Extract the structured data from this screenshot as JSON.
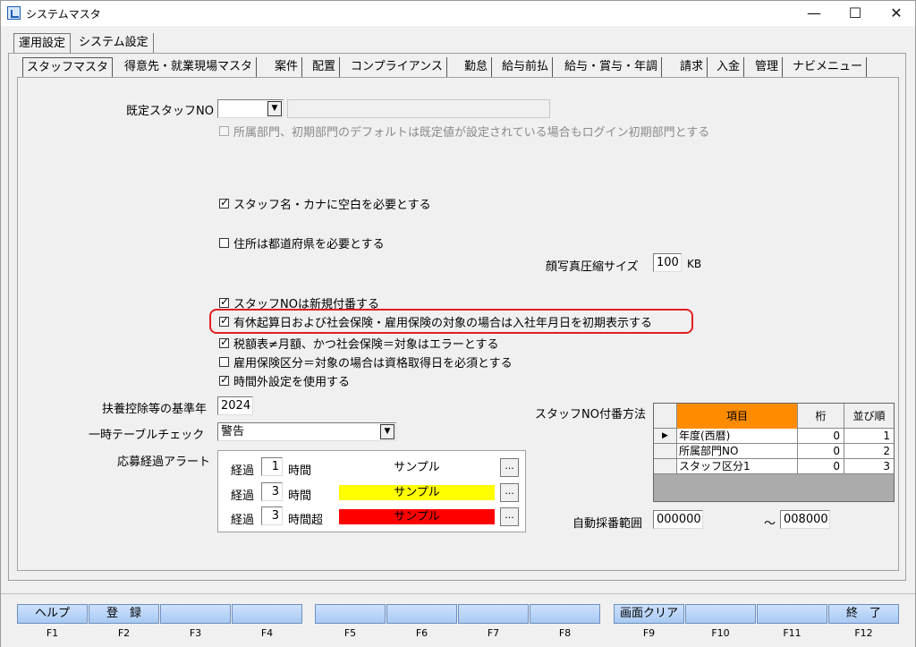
{
  "window": {
    "title": "システムマスタ",
    "minimize": "—",
    "maximize": "☐",
    "close": "✕"
  },
  "outer_tabs": [
    "運用設定",
    "システム設定"
  ],
  "inner_tabs": [
    "スタッフマスタ",
    "得意先・就業現場マスタ",
    "案件",
    "配置",
    "コンプライアンス",
    "勤怠",
    "給与前払",
    "給与・賞与・年調",
    "請求",
    "入金",
    "管理",
    "ナビメニュー"
  ],
  "form": {
    "default_staff_no_label": "既定スタッフNO",
    "default_staff_no_value": "",
    "default_staff_no_name": "",
    "dept_default_text": "所属部門、初期部門のデフォルトは既定値が設定されている場合もログイン初期部門とする",
    "staff_name_space_text": "スタッフ名・カナに空白を必要とする",
    "address_pref_text": "住所は都道府県を必要とする",
    "photo_size_label": "顔写真圧縮サイズ",
    "photo_size_value": "100",
    "photo_size_unit": "KB",
    "staff_no_auto_text": "スタッフNOは新規付番する",
    "paid_leave_text": "有休起算日および社会保険・雇用保険の対象の場合は入社年月日を初期表示する",
    "tax_table_text": "税額表≠月額、かつ社会保険＝対象はエラーとする",
    "employment_ins_text": "雇用保険区分＝対象の場合は資格取得日を必須とする",
    "overtime_text": "時間外設定を使用する",
    "deduction_year_label": "扶養控除等の基準年",
    "deduction_year_value": "2024",
    "temp_table_label": "一時テーブルチェック",
    "temp_table_value": "警告",
    "alert_label": "応募経過アラート",
    "alerts": [
      {
        "prefix": "経過",
        "hours": "1",
        "suffix": "時間",
        "sample": "サンプル",
        "color": "#ffffff",
        "text_color": "#000000"
      },
      {
        "prefix": "経過",
        "hours": "3",
        "suffix": "時間",
        "sample": "サンプル",
        "color": "#ffff00",
        "text_color": "#000000"
      },
      {
        "prefix": "経過",
        "hours": "3",
        "suffix": "時間超",
        "sample": "サンプル",
        "color": "#ff0000",
        "text_color": "#000000"
      }
    ],
    "dots_label": "...",
    "numbering_label": "スタッフNO付番方法",
    "numbering_headers": [
      "項目",
      "桁",
      "並び順"
    ],
    "numbering_rows": [
      {
        "item": "年度(西暦)",
        "digits": "0",
        "order": "1"
      },
      {
        "item": "所属部門NO",
        "digits": "0",
        "order": "2"
      },
      {
        "item": "スタッフ区分1",
        "digits": "0",
        "order": "3"
      }
    ],
    "auto_range_label": "自動採番範囲",
    "auto_range_from": "000000",
    "auto_range_tilde": "～",
    "auto_range_to": "008000"
  },
  "fkeys": [
    {
      "label": "ヘルプ",
      "key": "F1"
    },
    {
      "label": "登　録",
      "key": "F2"
    },
    {
      "label": "",
      "key": "F3"
    },
    {
      "label": "",
      "key": "F4"
    },
    {
      "label": "",
      "key": "F5"
    },
    {
      "label": "",
      "key": "F6"
    },
    {
      "label": "",
      "key": "F7"
    },
    {
      "label": "",
      "key": "F8"
    },
    {
      "label": "画面クリア",
      "key": "F9"
    },
    {
      "label": "",
      "key": "F10"
    },
    {
      "label": "",
      "key": "F11"
    },
    {
      "label": "終　了",
      "key": "F12"
    }
  ],
  "colors": {
    "highlight": "#e02020",
    "grid_header": "#ff8c00",
    "fkey_button": "#b9d3f5"
  }
}
